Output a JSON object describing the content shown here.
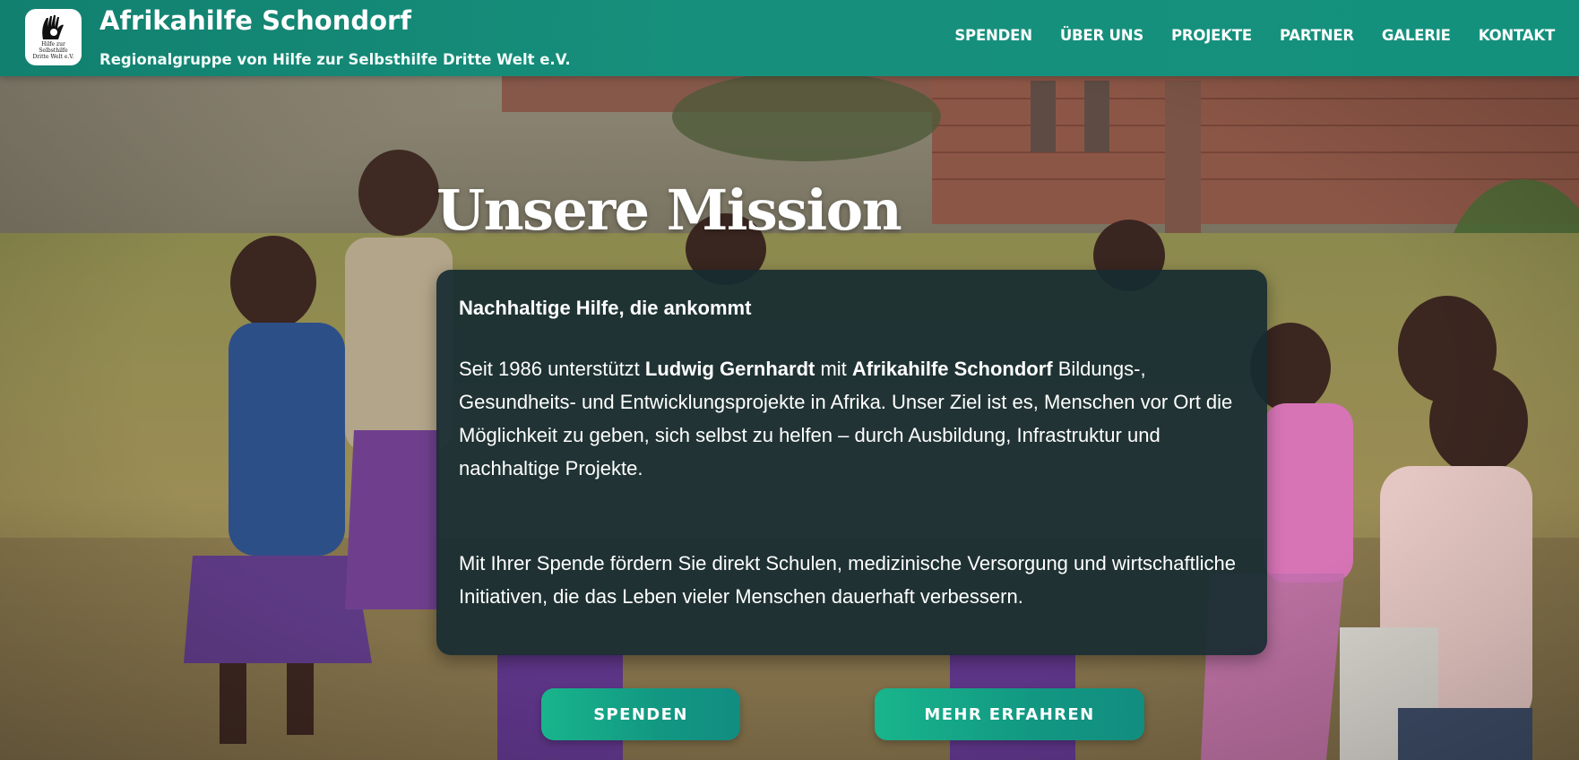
{
  "header": {
    "title": "Afrikahilfe Schondorf",
    "subtitle": "Regionalgruppe von Hilfe zur Selbsthilfe Dritte Welt e.V.",
    "logo_text": [
      "Hilfe zur",
      "Selbsthilfe",
      "Dritte Welt e.V."
    ]
  },
  "nav": {
    "items": [
      "SPENDEN",
      "ÜBER UNS",
      "PROJEKTE",
      "PARTNER",
      "GALERIE",
      "KONTAKT"
    ]
  },
  "mission": {
    "title": "Unsere Mission",
    "heading": "Nachhaltige Hilfe, die ankommt",
    "para1_part1": "Seit 1986 unterstützt ",
    "para1_bold1": "Ludwig Gernhardt",
    "para1_part2": " mit ",
    "para1_bold2": "Afrikahilfe Schondorf",
    "para1_part3": " Bildungs-, Gesundheits- und Entwicklungsprojekte in Afrika. Unser Ziel ist es, Menschen vor Ort die Möglichkeit zu geben, sich selbst zu helfen – durch Ausbildung, Infrastruktur und nachhaltige Projekte.",
    "para2": "Mit Ihrer Spende fördern Sie direkt Schulen, medizinische Versorgung und wirtschaftliche Initiativen, die das Leben vieler Menschen dauerhaft verbessern."
  },
  "cta": {
    "donate_label": "SPENDEN",
    "more_label": "MEHR ERFAHREN"
  },
  "colors": {
    "header_teal": "#14917d",
    "card_bg": "#182c32",
    "button_green": "#18b58c"
  }
}
